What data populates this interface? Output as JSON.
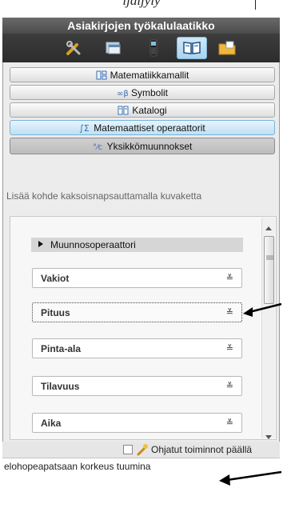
{
  "top_text": "ijaljyly",
  "panel": {
    "title": "Asiakirjojen työkalulaatikko",
    "toolbar_icons": [
      "tools-icon",
      "window-icon",
      "calculator-icon",
      "book-icon",
      "folder-icon"
    ]
  },
  "categories": [
    {
      "label": "Matematiikkamallit",
      "icon": "templates-icon"
    },
    {
      "label": "Symbolit",
      "icon": "symbols-icon"
    },
    {
      "label": "Katalogi",
      "icon": "catalog-icon"
    },
    {
      "label": "Matemaattiset operaattorit",
      "icon": "sigma-icon"
    },
    {
      "label": "Yksikkömuunnokset",
      "icon": "unit-conversion-icon"
    }
  ],
  "hint": "Lisää kohde kaksoisnapsauttamalla kuvaketta",
  "list": {
    "group_header": "Muunnosoperaattori",
    "items": [
      "Vakiot",
      "Pituus",
      "Pinta-ala",
      "Tilavuus",
      "Aika"
    ]
  },
  "footer": {
    "checkbox_label": "Ohjatut toiminnot päällä",
    "checkbox_checked": false
  },
  "text_area_value": "elohopeapatsaan korkeus tuumina",
  "colors": {
    "title_bar": "#575757",
    "toolbar": "#333333",
    "selected_tab": "#bfe0f3",
    "pressed_tab": "#c6c6c6"
  }
}
